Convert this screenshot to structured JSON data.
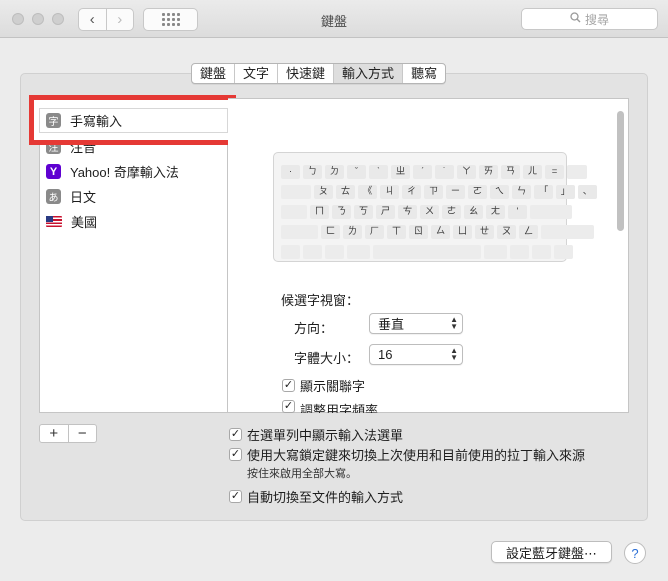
{
  "window": {
    "title": "鍵盤",
    "search_placeholder": "搜尋"
  },
  "tabs": [
    "鍵盤",
    "文字",
    "快速鍵",
    "輸入方式",
    "聽寫"
  ],
  "selected_tab": "輸入方式",
  "input_sources": [
    {
      "label": "手寫輸入",
      "icon": "handwriting-icon",
      "glyph": "字"
    },
    {
      "label": "注音",
      "icon": "zhuyin-icon",
      "glyph": "注"
    },
    {
      "label": "Yahoo! 奇摩輸入法",
      "icon": "yahoo-icon",
      "glyph": "Y"
    },
    {
      "label": "日文",
      "icon": "japanese-icon",
      "glyph": "あ"
    },
    {
      "label": "美國",
      "icon": "us-flag-icon",
      "glyph": ""
    }
  ],
  "keyboard_rows": [
    [
      "·",
      "ㄅ",
      "ㄉ",
      "ˇ",
      "ˋ",
      "ㄓ",
      "ˊ",
      "˙",
      "ㄚ",
      "ㄞ",
      "ㄢ",
      "ㄦ",
      "="
    ],
    [
      "ㄆ",
      "ㄊ",
      "《",
      "ㄐ",
      "ㄔ",
      "ㄗ",
      "ㄧ",
      "ㄛ",
      "ㄟ",
      "ㄣ",
      "「",
      "」",
      "、"
    ],
    [
      "ㄇ",
      "ㄋ",
      "ㄎ",
      "ㄕ",
      "ㄘ",
      "ㄨ",
      "ㄜ",
      "ㄠ",
      "ㄤ",
      "'"
    ],
    [
      "ㄈ",
      "ㄌ",
      "ㄏ",
      "ㄒ",
      "ㄖ",
      "ㄙ",
      "ㄩ",
      "ㄝ",
      "ㄡ",
      "ㄥ"
    ]
  ],
  "candidate_window": {
    "heading": "候選字視窗：",
    "direction_label": "方向：",
    "direction_value": "垂直",
    "font_size_label": "字體大小：",
    "font_size_value": "16"
  },
  "pane_options": [
    {
      "label": "顯示關聯字",
      "checked": true
    },
    {
      "label": "調整用字頻率",
      "checked": true
    }
  ],
  "bottom_options": {
    "show_menu": {
      "label": "在選單列中顯示輸入法選單",
      "checked": true
    },
    "caps_lock": {
      "label": "使用大寫鎖定鍵來切換上次使用和目前使用的拉丁輸入來源",
      "checked": true
    },
    "caps_lock_note": "按住來啟用全部大寫。",
    "auto_switch": {
      "label": "自動切換至文件的輸入方式",
      "checked": true
    }
  },
  "buttons": {
    "add": "+",
    "remove": "−",
    "bluetooth": "設定藍牙鍵盤⋯",
    "help": "?"
  },
  "colors": {
    "highlight": "#e53935",
    "yahoo": "#5f01d1"
  }
}
